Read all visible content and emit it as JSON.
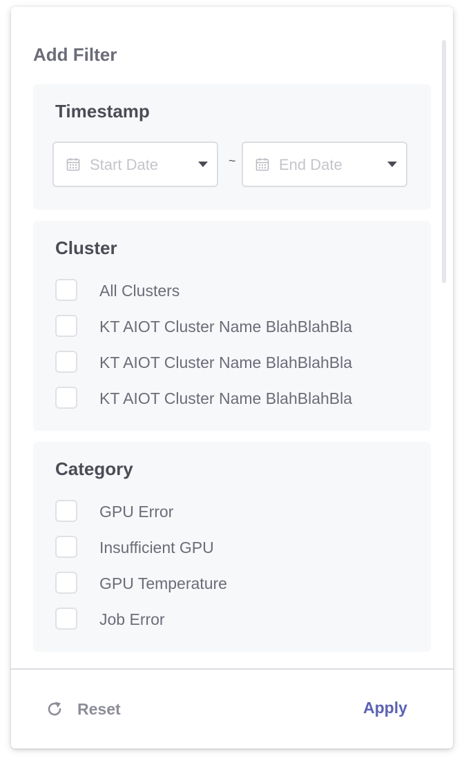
{
  "panel": {
    "title": "Add Filter"
  },
  "timestamp": {
    "title": "Timestamp",
    "start_placeholder": "Start Date",
    "end_placeholder": "End Date",
    "separator": "~"
  },
  "cluster": {
    "title": "Cluster",
    "options": [
      {
        "label": "All Clusters",
        "checked": false
      },
      {
        "label": "KT AIOT Cluster Name BlahBlahBla",
        "checked": false
      },
      {
        "label": "KT AIOT Cluster Name BlahBlahBla",
        "checked": false
      },
      {
        "label": "KT AIOT Cluster Name BlahBlahBla",
        "checked": false
      }
    ]
  },
  "category": {
    "title": "Category",
    "options": [
      {
        "label": "GPU Error",
        "checked": false
      },
      {
        "label": "Insufficient GPU",
        "checked": false
      },
      {
        "label": "GPU Temperature",
        "checked": false
      },
      {
        "label": "Job Error",
        "checked": false
      }
    ]
  },
  "footer": {
    "reset_label": "Reset",
    "apply_label": "Apply"
  },
  "icons": {
    "calendar": "calendar-icon",
    "reset": "refresh-icon",
    "dropdown": "caret-down-icon"
  },
  "colors": {
    "accent": "#5b62b3",
    "section_bg": "#f7f8fa",
    "muted_text": "#6b6c78",
    "placeholder": "#c4c5cc"
  }
}
